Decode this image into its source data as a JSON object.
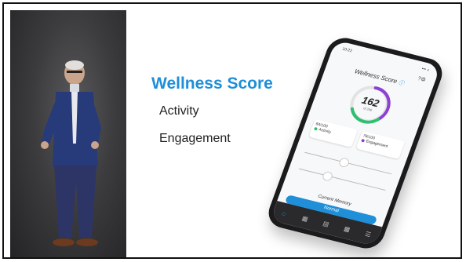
{
  "slide": {
    "title": "Wellness Score",
    "bullets": [
      "Activity",
      "Engagement"
    ]
  },
  "phone": {
    "time": "10:22",
    "signal": "••• ◖",
    "screen_title": "Wellness Score",
    "score": "162",
    "score_of": "of 200",
    "activity": {
      "value": "84/100",
      "label": "Activity",
      "color": "#2fbf71"
    },
    "engagement": {
      "value": "78/100",
      "label": "Engagement",
      "color": "#8e3fd6"
    },
    "memory_label": "Current Memory",
    "memory_value": "Normal",
    "accent": "#1e8fd8",
    "nav_icons": [
      "home-icon",
      "stats-icon",
      "device-icon",
      "settings-icon",
      "menu-icon"
    ]
  }
}
